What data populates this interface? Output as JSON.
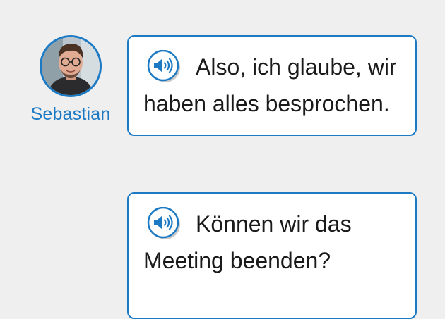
{
  "speaker": {
    "name": "Sebastian",
    "avatar_icon": "person-photo"
  },
  "messages": [
    {
      "text": "Also, ich glaube, wir haben alles besprochen.",
      "audio_icon": "speaker-volume-icon"
    },
    {
      "text": "Können wir das Meeting beenden?",
      "audio_icon": "speaker-volume-icon"
    }
  ],
  "colors": {
    "accent": "#1c7ac4",
    "background": "#efefef",
    "bubble_background": "#ffffff"
  }
}
